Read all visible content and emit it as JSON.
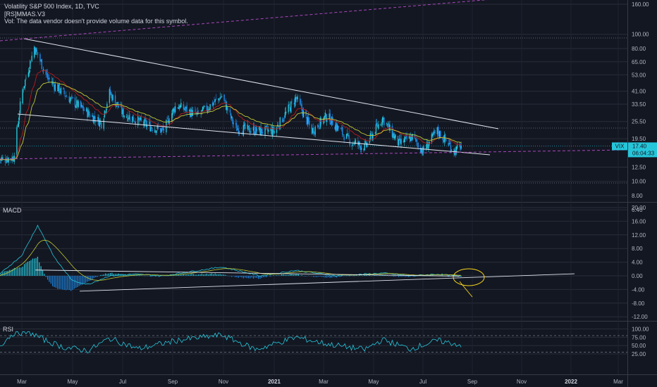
{
  "header": {
    "title": "Volatility S&P 500 Index, 1D, TVC",
    "indicator": "[RS]MMAS.V3",
    "volume_note": "Vol: The data vendor doesn't provide volume data for this symbol."
  },
  "panes": {
    "macd_label": "MACD",
    "rsi_label": "RSI"
  },
  "price_badge": {
    "symbol": "VIX",
    "value": "17.40",
    "countdown": "06:04:33"
  },
  "colors": {
    "background": "#131722",
    "bull": "#26c6da",
    "bear": "#1e88e5",
    "ma_fast": "#b71c1c",
    "ma_slow": "#c0ca33",
    "trendline": "#e0e3eb",
    "dashed_channel": "#ab47bc",
    "badge": "#26c6da",
    "ellipse": "#f9d71c"
  },
  "chart_data": [
    {
      "type": "candlestick",
      "scale": "log",
      "x_ticks": [
        "Mar",
        "May",
        "Jul",
        "Sep",
        "Nov",
        "2021",
        "Mar",
        "May",
        "Jul",
        "Sep",
        "Nov",
        "2022",
        "Mar"
      ],
      "y_ticks": [
        "160.00",
        "100.00",
        "80.00",
        "65.00",
        "53.00",
        "41.00",
        "33.50",
        "25.50",
        "19.50",
        "12.50",
        "10.00",
        "8.00",
        "6.40"
      ],
      "close_path": [
        [
          "2020-02-01",
          14
        ],
        [
          "2020-02-20",
          14.5
        ],
        [
          "2020-03-01",
          40
        ],
        [
          "2020-03-16",
          82
        ],
        [
          "2020-04-01",
          50
        ],
        [
          "2020-04-15",
          42
        ],
        [
          "2020-05-01",
          35
        ],
        [
          "2020-05-20",
          29
        ],
        [
          "2020-06-05",
          25
        ],
        [
          "2020-06-15",
          40
        ],
        [
          "2020-07-01",
          29
        ],
        [
          "2020-08-01",
          24
        ],
        [
          "2020-08-20",
          22
        ],
        [
          "2020-09-05",
          33
        ],
        [
          "2020-10-01",
          28
        ],
        [
          "2020-10-30",
          38
        ],
        [
          "2020-11-15",
          23
        ],
        [
          "2020-12-15",
          22
        ],
        [
          "2021-01-01",
          22
        ],
        [
          "2021-01-27",
          37
        ],
        [
          "2021-02-15",
          22
        ],
        [
          "2021-03-05",
          28
        ],
        [
          "2021-04-01",
          19
        ],
        [
          "2021-04-20",
          17
        ],
        [
          "2021-05-12",
          27
        ],
        [
          "2021-06-01",
          18
        ],
        [
          "2021-06-18",
          20
        ],
        [
          "2021-07-01",
          16
        ],
        [
          "2021-07-19",
          22
        ],
        [
          "2021-08-10",
          16
        ],
        [
          "2021-08-18",
          17.4
        ]
      ],
      "last_close": 17.4
    },
    {
      "type": "line",
      "name": "MACD",
      "y_ticks": [
        "20.00",
        "16.00",
        "12.00",
        "8.00",
        "4.00",
        "0.00",
        "-4.00",
        "-8.00",
        "-12.00"
      ],
      "macd_path": [
        [
          "2020-02-01",
          0
        ],
        [
          "2020-03-01",
          6
        ],
        [
          "2020-03-20",
          14.8
        ],
        [
          "2020-04-10",
          5
        ],
        [
          "2020-05-01",
          -1.5
        ],
        [
          "2020-05-20",
          -2.5
        ],
        [
          "2020-06-15",
          0
        ],
        [
          "2020-07-15",
          0.5
        ],
        [
          "2020-08-20",
          0
        ],
        [
          "2020-10-30",
          2.6
        ],
        [
          "2020-12-15",
          0
        ],
        [
          "2021-01-27",
          1.6
        ],
        [
          "2021-03-15",
          0
        ],
        [
          "2021-05-12",
          0.8
        ],
        [
          "2021-06-15",
          0
        ],
        [
          "2021-07-20",
          0.5
        ],
        [
          "2021-08-18",
          -0.2
        ]
      ]
    },
    {
      "type": "line",
      "name": "RSI",
      "y_ticks": [
        "100.00",
        "75.00",
        "50.00",
        "25.00"
      ],
      "rsi_path": [
        [
          "2020-02-01",
          45
        ],
        [
          "2020-02-20",
          88
        ],
        [
          "2020-03-10",
          90
        ],
        [
          "2020-03-30",
          65
        ],
        [
          "2020-04-20",
          45
        ],
        [
          "2020-05-20",
          35
        ],
        [
          "2020-06-15",
          72
        ],
        [
          "2020-07-20",
          40
        ],
        [
          "2020-09-05",
          65
        ],
        [
          "2020-10-30",
          82
        ],
        [
          "2020-12-10",
          38
        ],
        [
          "2021-01-27",
          75
        ],
        [
          "2021-03-05",
          55
        ],
        [
          "2021-04-20",
          38
        ],
        [
          "2021-05-12",
          68
        ],
        [
          "2021-06-15",
          40
        ],
        [
          "2021-07-19",
          65
        ],
        [
          "2021-08-18",
          52
        ]
      ]
    }
  ]
}
